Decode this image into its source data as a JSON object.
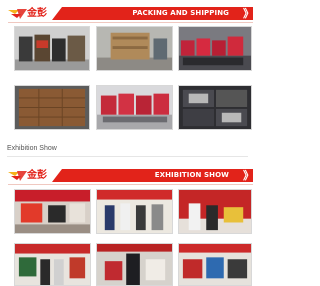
{
  "packing": {
    "brand_text": "金彭",
    "title": "PACKING AND SHIPPING",
    "arrows": "》",
    "photos": [
      "packed-crates-warehouse",
      "wooden-crate-loading",
      "red-tricycles-rows",
      "brown-boxes-container",
      "red-vehicles-container",
      "crated-vehicles-stack"
    ]
  },
  "exhibition_heading": "Exhibition Show",
  "exhibition": {
    "brand_text": "金彭",
    "title": "EXHIBITION SHOW",
    "arrows": "》",
    "photos": [
      "booth-red-display",
      "visitors-group",
      "booth-red-walls",
      "vehicle-booth-outdoor",
      "man-in-suit-booth",
      "tricycle-display-hall"
    ]
  },
  "colors": {
    "brand_red": "#e2231a",
    "brand_yellow": "#f6b21b"
  }
}
